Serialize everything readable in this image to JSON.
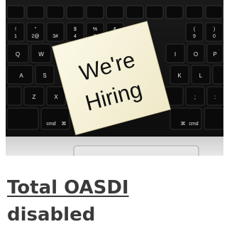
{
  "image": {
    "note_lines": [
      "We're",
      "Hiring"
    ],
    "keys": {
      "row1": [
        "!\n1",
        "@\n2",
        "#\n3",
        "$\n4",
        "%\n5",
        "^\n6",
        "",
        "",
        "",
        "(\n9",
        ")\n0"
      ],
      "row2": [
        "Q",
        "W",
        "",
        "",
        "",
        "",
        "",
        "",
        "I",
        "O",
        "P"
      ],
      "row3": [
        "A",
        "S",
        "",
        "",
        "",
        "",
        "",
        "K",
        "L"
      ],
      "row4": [
        "Z",
        "X",
        "",
        "",
        "",
        "",
        "",
        ";",
        ":"
      ],
      "cmd_left": "cmd",
      "cmd_right": "cmd",
      "cmd_symbol": "⌘"
    }
  },
  "caption": {
    "link_text": "Total OASDI",
    "sub_text": "disabled"
  }
}
